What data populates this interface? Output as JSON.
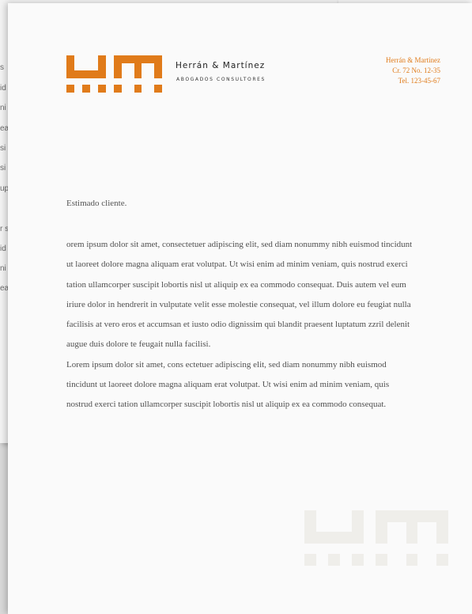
{
  "letterhead": {
    "firm_name": "Herrán & Martínez",
    "firm_subtitle": "ABOGADOS CONSULTORES",
    "logo_text": "HM",
    "contact": {
      "name": "Herrán & Martínez",
      "address": "Cr. 72 No. 12-35",
      "phone": "Tel. 123-45-67"
    },
    "colors": {
      "accent": "#e07b1a",
      "watermark": "#efeeea",
      "text": "#505050"
    }
  },
  "letter": {
    "greeting": "Estimado cliente.",
    "paragraphs": [
      "orem ipsum dolor sit amet, consectetuer adipiscing elit, sed diam nonummy nibh euismod tincidunt ut laoreet dolore magna aliquam erat volutpat. Ut wisi enim ad minim veniam, quis nostrud exerci tation ullamcorper suscipit lobortis nisl ut aliquip ex ea commodo consequat. Duis autem vel eum iriure dolor in hendrerit in vulputate velit esse molestie consequat, vel illum dolore eu feugiat nulla facilisis at vero eros et accumsan et iusto odio dignissim qui blandit praesent luptatum zzril delenit augue duis dolore te feugait nulla facilisi.",
      "Lorem ipsum dolor sit amet, cons ectetuer adipiscing elit, sed diam nonummy nibh euismod tincidunt ut laoreet dolore magna aliquam erat volutpat. Ut wisi enim ad minim veniam, quis nostrud exerci tation ullamcorper suscipit lobortis nisl ut aliquip ex ea commodo consequat."
    ]
  },
  "back_sheet_fragments": [
    "s",
    "id",
    "ni",
    "ea",
    "si",
    "si",
    "up",
    "r s",
    "id",
    "ni",
    "ea"
  ]
}
